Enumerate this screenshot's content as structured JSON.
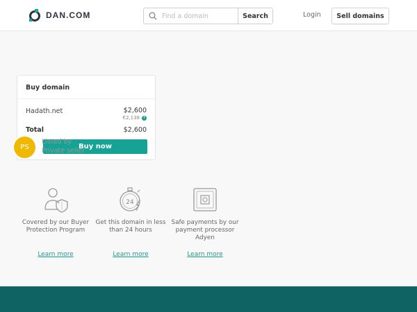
{
  "header": {
    "brand": "DAN.COM",
    "search": {
      "placeholder": "Find a domain",
      "value": "",
      "button_label": "Search"
    },
    "login_label": "Login",
    "sell_label": "Sell domains"
  },
  "buy_card": {
    "title": "Buy domain",
    "domain": "Hadath.net",
    "price_usd": "$2,600",
    "price_eur": "€2,138",
    "total_label": "Total",
    "total_value": "$2,600",
    "buy_button_label": "Buy now"
  },
  "seller": {
    "initials": "PS",
    "listed_by_label": "Listed by",
    "name": "Private seller"
  },
  "features": [
    {
      "icon": "shield-person-icon",
      "text": "Covered by our Buyer Protection Program",
      "link": "Learn more"
    },
    {
      "icon": "stopwatch-24-icon",
      "text": "Get this domain in less than 24 hours",
      "link": "Learn more"
    },
    {
      "icon": "safe-icon",
      "text": "Safe payments by our payment processor Adyen",
      "link": "Learn more"
    }
  ],
  "colors": {
    "accent": "#14a394",
    "footer": "#0f6362",
    "avatar": "#f0b800"
  }
}
